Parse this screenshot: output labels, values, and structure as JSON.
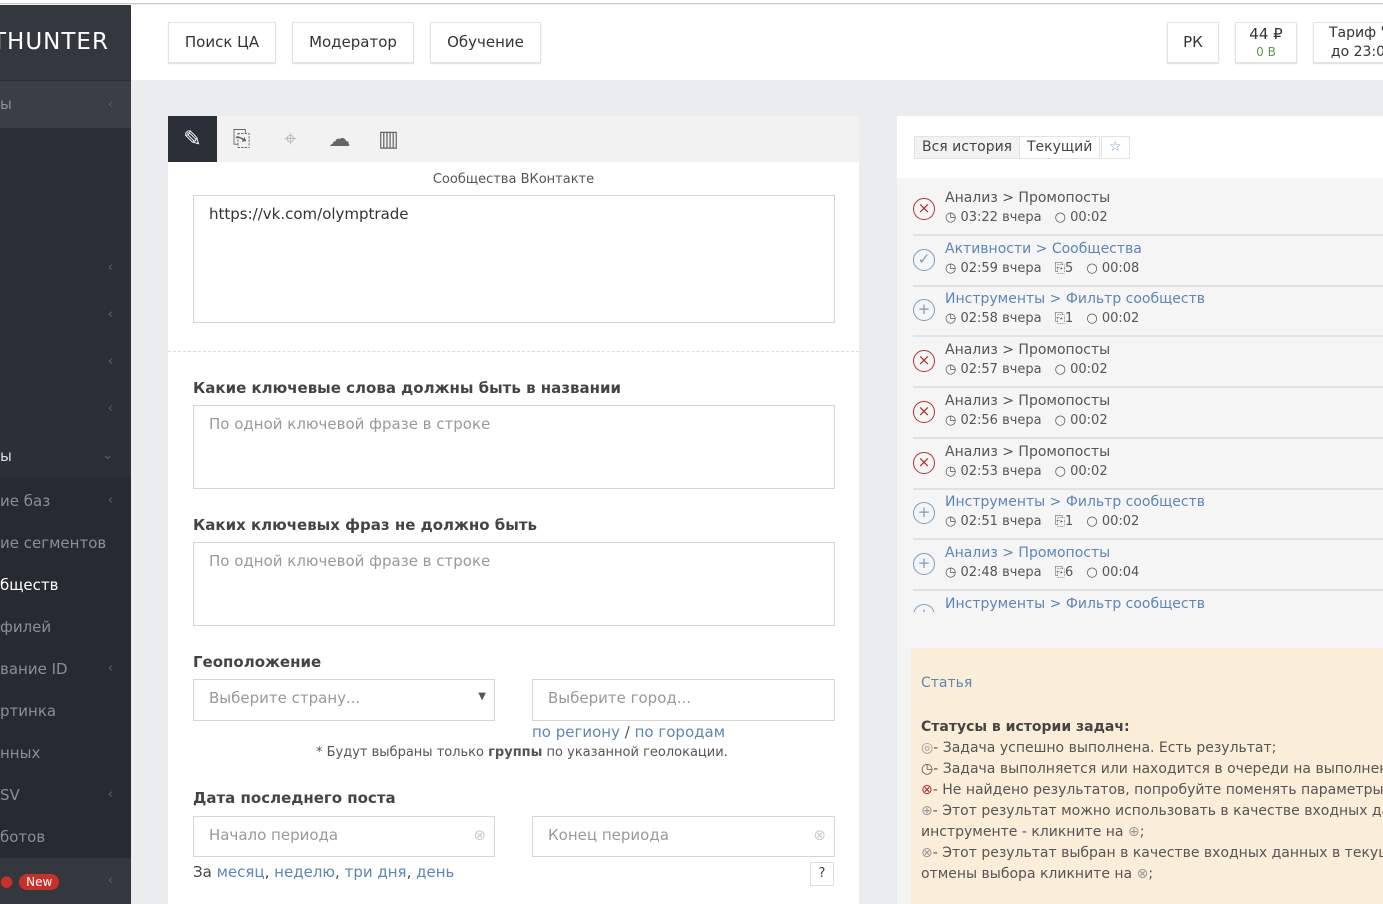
{
  "sidebar": {
    "logo": "THUNTER",
    "items": [
      {
        "label": "ы",
        "chev": "‹"
      },
      {
        "label": "",
        "chev": "‹"
      },
      {
        "label": "",
        "chev": "‹"
      },
      {
        "label": "",
        "chev": "‹"
      },
      {
        "label": "",
        "chev": "‹"
      },
      {
        "label": "ы",
        "chev": "⌄"
      },
      {
        "label": "ие баз",
        "chev": "‹"
      },
      {
        "label": "ие сегментов",
        "chev": ""
      },
      {
        "label": "бществ",
        "chev": ""
      },
      {
        "label": "филей",
        "chev": ""
      },
      {
        "label": "вание ID",
        "chev": "‹"
      },
      {
        "label": "ртинка",
        "chev": ""
      },
      {
        "label": "нных",
        "chev": ""
      },
      {
        "label": "SV",
        "chev": "‹"
      },
      {
        "label": "ботов",
        "chev": ""
      }
    ],
    "new_badge": "New"
  },
  "header": {
    "buttons": [
      "Поиск ЦА",
      "Модератор",
      "Обучение"
    ],
    "rk": "РК",
    "balance": "44 ₽",
    "balance_sub": "0 В",
    "tariff": "Тариф \"",
    "tariff_sub": "до 23:0"
  },
  "form": {
    "source_label": "Сообщества ВКонтакте",
    "source_value": "https://vk.com/olymptrade",
    "keywords_label": "Какие ключевые слова должны быть в названии",
    "keywords_placeholder": "По одной ключевой фразе в строке",
    "exclude_label": "Каких ключевых фраз не должно быть",
    "exclude_placeholder": "По одной ключевой фразе в строке",
    "geo_label": "Геоположение",
    "country_placeholder": "Выберите страну...",
    "city_placeholder": "Выберите город...",
    "by_region": "по региону",
    "sep": "/",
    "by_cities": "по городам",
    "geo_note_pre": "* Будут выбраны только ",
    "geo_note_bold": "группы",
    "geo_note_post": " по указанной геолокации.",
    "date_label": "Дата последнего поста",
    "start_placeholder": "Начало периода",
    "end_placeholder": "Конец периода",
    "period_pre": "За",
    "periods": [
      "месяц",
      "неделю",
      "три дня",
      "день"
    ],
    "help": "?"
  },
  "history": {
    "all": "Вся история",
    "current": "Текущий",
    "items": [
      {
        "status": "error",
        "title": "Анализ > Промопосты",
        "time": "03:22 вчера",
        "count": "",
        "duration": "00:02",
        "link": false
      },
      {
        "status": "done",
        "title": "Активности > Сообщества",
        "time": "02:59 вчера",
        "count": "5",
        "duration": "00:08",
        "link": true
      },
      {
        "status": "add",
        "title": "Инструменты > Фильтр сообществ",
        "time": "02:58 вчера",
        "count": "1",
        "duration": "00:02",
        "link": true
      },
      {
        "status": "error",
        "title": "Анализ > Промопосты",
        "time": "02:57 вчера",
        "count": "",
        "duration": "00:02",
        "link": false
      },
      {
        "status": "error",
        "title": "Анализ > Промопосты",
        "time": "02:56 вчера",
        "count": "",
        "duration": "00:02",
        "link": false
      },
      {
        "status": "error",
        "title": "Анализ > Промопосты",
        "time": "02:53 вчера",
        "count": "",
        "duration": "00:02",
        "link": false
      },
      {
        "status": "add",
        "title": "Инструменты > Фильтр сообществ",
        "time": "02:51 вчера",
        "count": "1",
        "duration": "00:02",
        "link": true
      },
      {
        "status": "add",
        "title": "Анализ > Промопосты",
        "time": "02:48 вчера",
        "count": "6",
        "duration": "00:04",
        "link": true
      },
      {
        "status": "add",
        "title": "Инструменты > Фильтр сообществ",
        "time": "",
        "count": "",
        "duration": "",
        "link": true
      }
    ]
  },
  "help": {
    "article": "Статья",
    "title": "Статусы в истории задач:",
    "lines": [
      "- Задача успешно выполнена. Есть результат;",
      "- Задача выполняется или находится в очереди на выполнен",
      "- Не найдено результатов, попробуйте поменять параметры",
      "- Этот результат можно использовать в качестве входных да",
      "инструменте - кликните на",
      "- Этот результат выбран в качестве входных данных в текуще",
      "отмены выбора кликните на"
    ]
  }
}
